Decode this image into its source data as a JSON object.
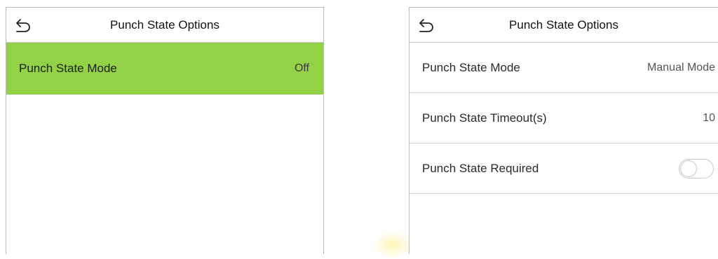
{
  "left_screen": {
    "title": "Punch State Options",
    "rows": [
      {
        "label": "Punch State Mode",
        "value": "Off",
        "selected": true
      }
    ]
  },
  "right_screen": {
    "title": "Punch State Options",
    "rows": [
      {
        "label": "Punch State Mode",
        "value": "Manual Mode"
      },
      {
        "label": "Punch State Timeout(s)",
        "value": "10"
      },
      {
        "label": "Punch State Required",
        "toggle": "off"
      }
    ]
  },
  "colors": {
    "selected_row": "#93d146",
    "border": "#b9b9b9"
  },
  "icons": {
    "back": "back-arrow-icon",
    "toggle": "toggle-switch-icon"
  }
}
